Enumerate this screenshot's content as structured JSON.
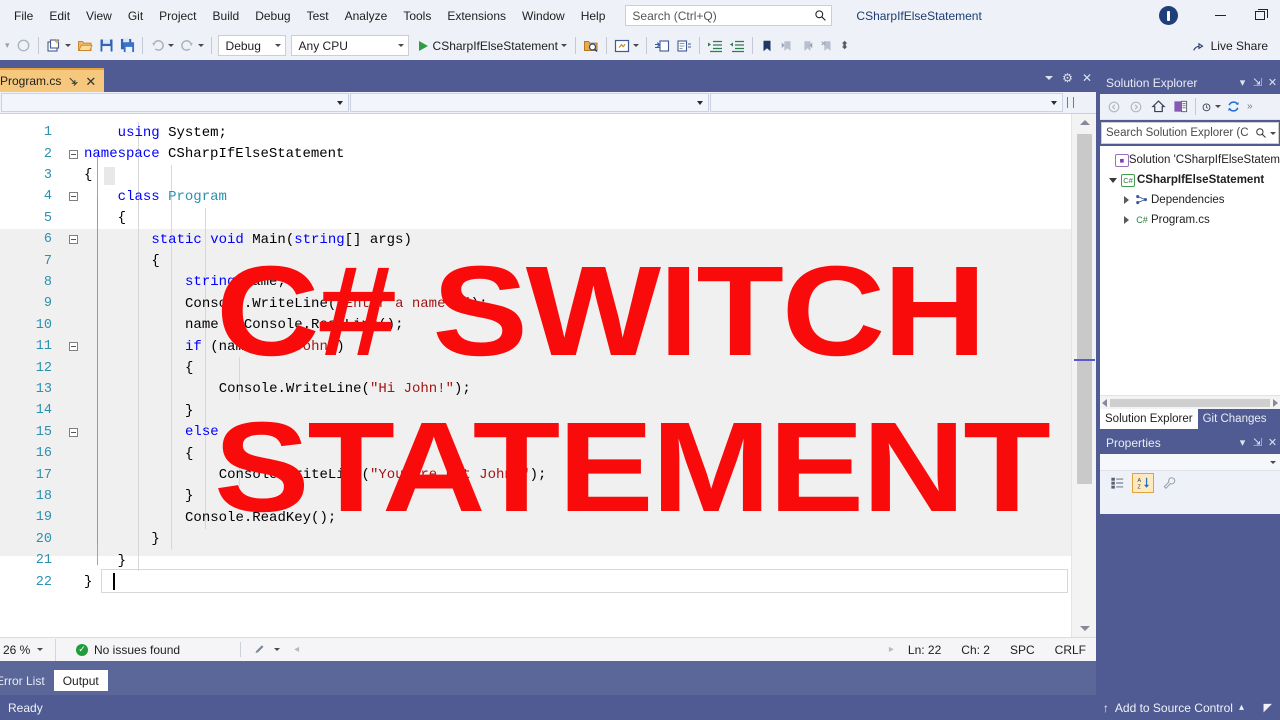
{
  "window": {
    "app_title": "CSharpIfElseStatement",
    "minimize_icon": "minimize-icon",
    "restore_icon": "restore-icon",
    "account_icon": "account-badge-icon"
  },
  "menu": {
    "items": [
      "File",
      "Edit",
      "View",
      "Git",
      "Project",
      "Build",
      "Debug",
      "Test",
      "Analyze",
      "Tools",
      "Extensions",
      "Window",
      "Help"
    ]
  },
  "search": {
    "placeholder": "Search (Ctrl+Q)",
    "icon": "search-icon"
  },
  "toolbar": {
    "back_icon": "navigate-back-icon",
    "forward_icon": "navigate-forward-icon",
    "new_project_icon": "new-project-icon",
    "open_icon": "open-file-icon",
    "save_icon": "save-icon",
    "save_all_icon": "save-all-icon",
    "undo_icon": "undo-icon",
    "redo_icon": "redo-icon",
    "config": "Debug",
    "platform": "Any CPU",
    "start_label": "CSharpIfElseStatement",
    "start_icon": "play-icon",
    "icons_right": [
      "find-in-files-icon",
      "preview-changes-icon",
      "comment-icon",
      "uncomment-icon",
      "increase-indent-icon",
      "decrease-indent-icon",
      "bookmark-icon",
      "prev-bookmark-icon",
      "next-bookmark-icon",
      "clear-bookmarks-icon"
    ],
    "live_share": "Live Share",
    "live_share_icon": "live-share-icon"
  },
  "document_tab": {
    "name": "Program.cs",
    "pin_icon": "pin-icon",
    "close_icon": "close-icon",
    "dropdown_icon": "chevron-down-icon",
    "settings_icon": "gear-icon"
  },
  "editor": {
    "lines": [
      {
        "n": "1",
        "indent": 4,
        "fold": "none",
        "tokens": [
          {
            "t": "using",
            "c": "k"
          },
          {
            "t": " System;",
            "c": "m"
          }
        ]
      },
      {
        "n": "2",
        "indent": 0,
        "fold": "open",
        "tokens": [
          {
            "t": "namespace",
            "c": "k"
          },
          {
            "t": " ",
            "c": "m"
          },
          {
            "t": "CSharpIfElseStatement",
            "c": "m"
          }
        ]
      },
      {
        "n": "3",
        "indent": 0,
        "fold": "none",
        "tokens": [
          {
            "t": "{",
            "c": "m"
          }
        ]
      },
      {
        "n": "4",
        "indent": 4,
        "fold": "open",
        "tokens": [
          {
            "t": "class",
            "c": "k"
          },
          {
            "t": " ",
            "c": "m"
          },
          {
            "t": "Program",
            "c": "t"
          }
        ]
      },
      {
        "n": "5",
        "indent": 4,
        "fold": "none",
        "tokens": [
          {
            "t": "{",
            "c": "m"
          }
        ]
      },
      {
        "n": "6",
        "indent": 8,
        "fold": "open",
        "tokens": [
          {
            "t": "static",
            "c": "k"
          },
          {
            "t": " ",
            "c": "m"
          },
          {
            "t": "void",
            "c": "k"
          },
          {
            "t": " ",
            "c": "m"
          },
          {
            "t": "Main",
            "c": "m"
          },
          {
            "t": "(",
            "c": "m"
          },
          {
            "t": "string",
            "c": "k"
          },
          {
            "t": "[] args)",
            "c": "m"
          }
        ]
      },
      {
        "n": "7",
        "indent": 8,
        "fold": "none",
        "tokens": [
          {
            "t": "{",
            "c": "m"
          }
        ]
      },
      {
        "n": "8",
        "indent": 12,
        "fold": "none",
        "tokens": [
          {
            "t": "string",
            "c": "k"
          },
          {
            "t": " name;",
            "c": "m"
          }
        ]
      },
      {
        "n": "9",
        "indent": 12,
        "fold": "none",
        "tokens": [
          {
            "t": "Console.WriteLine(",
            "c": "m"
          },
          {
            "t": "\"Enter a name: \"",
            "c": "s"
          },
          {
            "t": ");",
            "c": "m"
          }
        ]
      },
      {
        "n": "10",
        "indent": 12,
        "fold": "none",
        "tokens": [
          {
            "t": "name = Console.ReadLine();",
            "c": "m"
          }
        ]
      },
      {
        "n": "11",
        "indent": 12,
        "fold": "open",
        "tokens": [
          {
            "t": "if",
            "c": "k"
          },
          {
            "t": " (name == ",
            "c": "m"
          },
          {
            "t": "\"John\"",
            "c": "s"
          },
          {
            "t": ")",
            "c": "m"
          }
        ]
      },
      {
        "n": "12",
        "indent": 12,
        "fold": "none",
        "tokens": [
          {
            "t": "{",
            "c": "m"
          }
        ]
      },
      {
        "n": "13",
        "indent": 16,
        "fold": "none",
        "tokens": [
          {
            "t": "Console.WriteLine(",
            "c": "m"
          },
          {
            "t": "\"Hi John!\"",
            "c": "s"
          },
          {
            "t": ");",
            "c": "m"
          }
        ]
      },
      {
        "n": "14",
        "indent": 12,
        "fold": "none",
        "tokens": [
          {
            "t": "}",
            "c": "m"
          }
        ]
      },
      {
        "n": "15",
        "indent": 12,
        "fold": "open",
        "tokens": [
          {
            "t": "else",
            "c": "k"
          }
        ]
      },
      {
        "n": "16",
        "indent": 12,
        "fold": "none",
        "tokens": [
          {
            "t": "{",
            "c": "m"
          }
        ]
      },
      {
        "n": "17",
        "indent": 16,
        "fold": "none",
        "tokens": [
          {
            "t": "Console.WriteLine(",
            "c": "m"
          },
          {
            "t": "\"You are not John!\"",
            "c": "s"
          },
          {
            "t": ");",
            "c": "m"
          }
        ]
      },
      {
        "n": "18",
        "indent": 12,
        "fold": "none",
        "tokens": [
          {
            "t": "}",
            "c": "m"
          }
        ]
      },
      {
        "n": "19",
        "indent": 12,
        "fold": "none",
        "tokens": [
          {
            "t": "Console.ReadKey();",
            "c": "m"
          }
        ]
      },
      {
        "n": "20",
        "indent": 8,
        "fold": "none",
        "tokens": [
          {
            "t": "}",
            "c": "m"
          }
        ]
      },
      {
        "n": "21",
        "indent": 4,
        "fold": "none",
        "tokens": [
          {
            "t": "}",
            "c": "m"
          }
        ]
      },
      {
        "n": "22",
        "indent": 0,
        "fold": "none",
        "tokens": [
          {
            "t": "}",
            "c": "m"
          }
        ]
      }
    ]
  },
  "editor_status": {
    "zoom": "26 %",
    "issues_text": "No issues found",
    "issues_icon": "check-circle-icon",
    "pen_icon": "pen-icon",
    "line": "Ln: 22",
    "column": "Ch: 2",
    "spaces": "SPC",
    "eol": "CRLF"
  },
  "bottom_dock": {
    "tabs": [
      {
        "label": "Error List",
        "active": false
      },
      {
        "label": "Output",
        "active": true
      }
    ]
  },
  "solution_explorer": {
    "title": "Solution Explorer",
    "dropdown_icon": "chevron-down-icon",
    "pin_icon": "pin-icon",
    "close_icon": "close-icon",
    "toolbar_icons": [
      "back-icon",
      "forward-icon",
      "home-icon",
      "switch-views-icon",
      "pending-changes-icon",
      "refresh-icon"
    ],
    "search_placeholder": "Search Solution Explorer (C",
    "search_icon": "search-icon",
    "tree": [
      {
        "label": "Solution 'CSharpIfElseStatem",
        "icon": "solution-icon",
        "expander": "none",
        "depth": 0,
        "bold": false
      },
      {
        "label": "CSharpIfElseStatement",
        "icon": "csharp-project-icon",
        "expander": "down",
        "depth": 0,
        "bold": true
      },
      {
        "label": "Dependencies",
        "icon": "dependencies-icon",
        "expander": "right",
        "depth": 1,
        "bold": false
      },
      {
        "label": "Program.cs",
        "icon": "csharp-file-icon",
        "expander": "right",
        "depth": 1,
        "bold": false
      }
    ],
    "dock_tabs": [
      {
        "label": "Solution Explorer",
        "active": true
      },
      {
        "label": "Git Changes",
        "active": false
      }
    ]
  },
  "properties": {
    "title": "Properties",
    "dropdown_icon": "chevron-down-icon",
    "pin_icon": "pin-icon",
    "close_icon": "close-icon",
    "categorized_icon": "categorized-view-icon",
    "alphabetical_icon": "alphabetical-sort-icon",
    "events_icon": "properties-wrench-icon"
  },
  "statusbar": {
    "ready": "Ready",
    "source_control": "Add to Source Control",
    "source_control_icon": "arrow-up-icon",
    "source_control_caret": "chevron-up-icon"
  },
  "overlay": {
    "line1": "C# SWITCH",
    "line2": "STATEMENT",
    "color": "#f90b0b"
  }
}
